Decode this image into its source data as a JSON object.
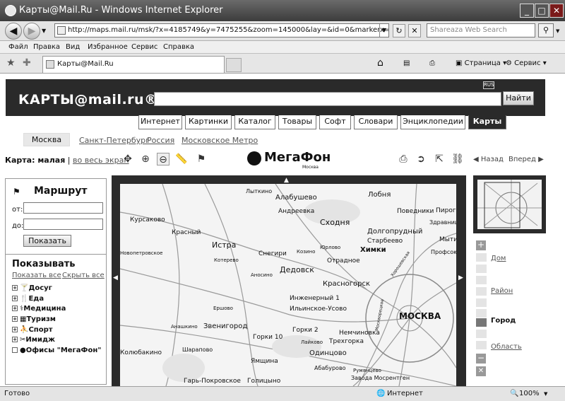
{
  "window": {
    "title": "Карты@Mail.Ru - Windows Internet Explorer",
    "minimize": "_",
    "maximize": "□",
    "close": "✕"
  },
  "address": {
    "url": "http://maps.mail.ru/msk/?x=4185749&y=7475255&zoom=145000&lay=&id=0&markerx=0&markery=0&",
    "search_placeholder": "Shareaza Web Search"
  },
  "menu": [
    "Файл",
    "Правка",
    "Вид",
    "Избранное",
    "Сервис",
    "Справка"
  ],
  "tab": {
    "label": "Карты@Mail.Ru"
  },
  "toolbar": {
    "page_label": "Страница",
    "tools_label": "Сервис"
  },
  "site": {
    "logo": "КАРТЫ@mail.ru®",
    "rus": "RUS",
    "find_button": "Найти"
  },
  "services": [
    "Интернет",
    "Картинки",
    "Каталог",
    "Товары",
    "Софт",
    "Словари",
    "Энциклопедии",
    "Карты"
  ],
  "cities": {
    "active": "Москва",
    "links": [
      "Санкт-Петербург",
      "Россия",
      "Московское Метро"
    ]
  },
  "mapbar": {
    "size_label": "Карта: малая",
    "separator": "|",
    "fullscreen": "во весь экран",
    "sponsor": "МегаФон",
    "sponsor_city": "Москва",
    "back": "Назад",
    "forward": "Вперед"
  },
  "route": {
    "title": "Маршрут",
    "from_label": "от:",
    "to_label": "до:",
    "show_button": "Показать"
  },
  "show_panel": {
    "title": "Показывать",
    "show_all": "Показать все",
    "hide_all": "Скрыть все",
    "categories": [
      "Досуг",
      "Еда",
      "Медицина",
      "Туризм",
      "Спорт",
      "Имидж",
      "Офисы \"МегаФон\""
    ]
  },
  "zoom_labels": {
    "home": "Дом",
    "district": "Район",
    "city": "Город",
    "region": "Область"
  },
  "map_labels": [
    "Лыткино",
    "Алабушево",
    "Лобня",
    "Курсаково",
    "Андреевка",
    "Сходня",
    "Поведники",
    "Пирогов",
    "Красный",
    "Долгопрудный",
    "Здравница",
    "Истра",
    "Старбеево",
    "Мыти",
    "Новопетровское",
    "Снегири",
    "Козино",
    "Юрлово",
    "Химки",
    "Профсоюз",
    "Котерево",
    "Дедовск",
    "Отрадное",
    "Аносино",
    "Красногорск",
    "Инженерный 1",
    "Ильинское-Усово",
    "Ершово",
    "МОСКВА",
    "Звенигород",
    "Немчиновка",
    "Анашкино",
    "Горки 10",
    "Горки 2",
    "Колюбакино",
    "Трехгорка",
    "Одинцово",
    "Шарапово",
    "Лайково",
    "Ямщина",
    "Абабурово",
    "Румянцево",
    "Гарь-Покровское",
    "Голицыно",
    "Завода Мосрентген",
    "Москворецкое",
    "Хорошевская"
  ],
  "status": {
    "ready": "Готово",
    "zone": "Интернет",
    "zoom": "100%"
  }
}
